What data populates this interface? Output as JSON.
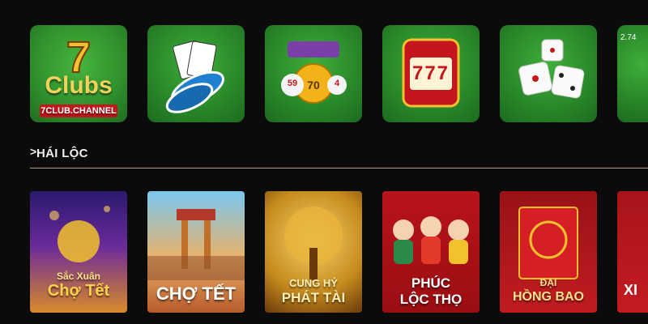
{
  "categories": [
    {
      "name": "7clubs-logo",
      "brand_top": "Clubs",
      "brand_bottom": "7CLUB.CHANNEL"
    },
    {
      "name": "card-casino",
      "icon": "playing-cards-chips-icon"
    },
    {
      "name": "lottery",
      "icon": "lottery-balls-icon",
      "numbers": [
        "59",
        "70",
        "4"
      ]
    },
    {
      "name": "slots",
      "icon": "slot-machine-777-icon",
      "label": "777"
    },
    {
      "name": "dice",
      "icon": "dice-icon"
    },
    {
      "name": "partial",
      "value": "2.74"
    }
  ],
  "section": {
    "title": "HÁI LỘC",
    "chevron": ">"
  },
  "games": [
    {
      "name": "sac-xuan-cho-tet",
      "title_line1": "Sắc Xuân",
      "title_line2": "Chợ Tết"
    },
    {
      "name": "cho-tet",
      "title": "CHỢ TẾT"
    },
    {
      "name": "cung-hy-phat-tai",
      "title_line1": "CUNG HỶ",
      "title_line2": "PHÁT TÀI"
    },
    {
      "name": "phuc-loc-tho",
      "title_line1": "PHÚC",
      "title_line2": "LỘC THỌ"
    },
    {
      "name": "dai-hong-bao",
      "title_line1": "ĐẠI",
      "title_line2": "HỒNG BAO"
    },
    {
      "name": "partial-game",
      "title": "XI"
    }
  ],
  "colors": {
    "bg": "#0b0b0b",
    "tile_green": "#2a8a2a",
    "accent_gold": "#f2c12e",
    "red": "#c4161c"
  }
}
